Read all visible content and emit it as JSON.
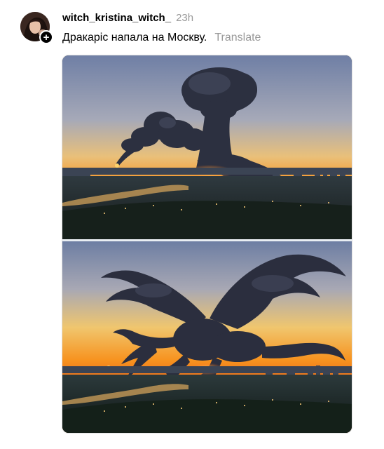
{
  "post": {
    "username": "witch_kristina_witch_",
    "time": "23h",
    "caption": "Дракаріс напала на Москву.",
    "translate_label": "Translate"
  },
  "icons": {
    "follow": "plus-icon"
  },
  "colors": {
    "secondary_text": "#999999",
    "sky_top": "#6f7fa5",
    "sky_glow": "#f7a23a",
    "smoke": "#2b2e3e"
  }
}
